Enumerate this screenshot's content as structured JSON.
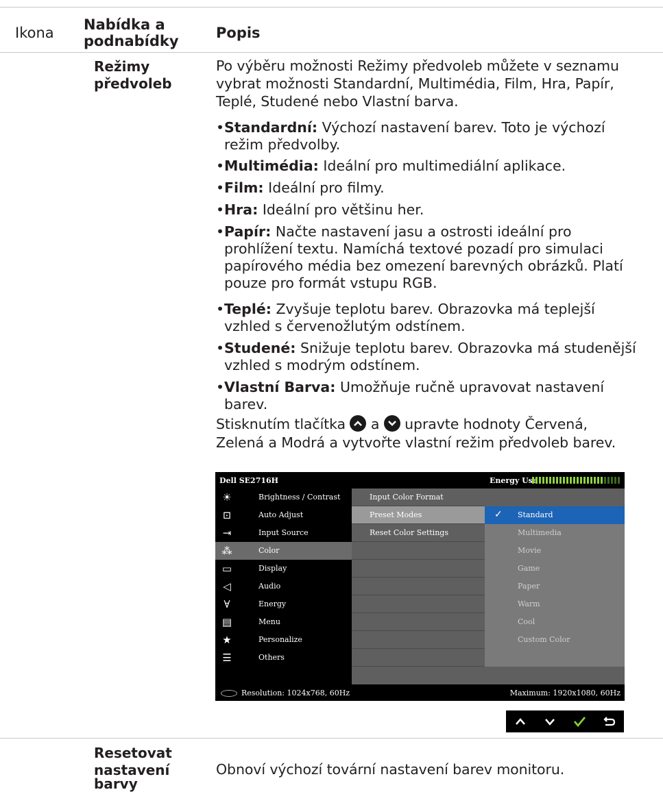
{
  "header": {
    "col1": "Ikona",
    "col2_line1": "Nabídka a",
    "col2_line2": "podnabídky",
    "col3": "Popis"
  },
  "section1": {
    "label_line1": "Režimy",
    "label_line2": "předvoleb",
    "intro": [
      "Po výběru možnosti Režimy předvoleb můžete v seznamu",
      "vybrat možnosti Standardní, Multimédia, Film, Hra, Papír,",
      "Teplé, Studené nebo Vlastní barva."
    ],
    "bullets": [
      {
        "term": "Standardní:",
        "lines": [
          "Výchozí nastavení barev. Toto je výchozí",
          "režim předvolby."
        ]
      },
      {
        "term": "Multimédia:",
        "lines": [
          "Ideální pro multimediální aplikace."
        ]
      },
      {
        "term": "Film:",
        "lines": [
          "Ideální pro filmy."
        ]
      },
      {
        "term": "Hra:",
        "lines": [
          "Ideální pro většinu her."
        ]
      },
      {
        "term": "Papír:",
        "lines": [
          "Načte nastavení jasu a ostrosti ideální pro",
          "prohlížení textu. Namíchá textové pozadí pro simulaci",
          "papírového média bez omezení barevných obrázků. Platí",
          "pouze pro formát vstupu RGB."
        ]
      },
      {
        "term": "Teplé:",
        "lines": [
          "Zvyšuje teplotu barev. Obrazovka má teplejší",
          "vzhled s červenožlutým odstínem."
        ]
      },
      {
        "term": "Studené:",
        "lines": [
          "Snižuje teplotu barev. Obrazovka má studenější",
          "vzhled s modrým odstínem."
        ]
      },
      {
        "term": "Vlastní Barva:",
        "lines": [
          "Umožňuje ručně upravovat nastavení",
          "barev."
        ]
      }
    ],
    "press_pre": "Stisknutím tlačítka",
    "press_mid": "a",
    "press_post": "upravte hodnoty Červená,",
    "press_line2": "Zelená a Modrá a vytvořte vlastní režim předvoleb barev."
  },
  "osd": {
    "title": "Dell SE2716H",
    "energy_label": "Energy Use",
    "energy_level": 0.8,
    "menu": [
      {
        "icon": "brightness-icon",
        "label": "Brightness / Contrast"
      },
      {
        "icon": "auto-adjust-icon",
        "label": "Auto Adjust"
      },
      {
        "icon": "input-source-icon",
        "label": "Input Source"
      },
      {
        "icon": "color-icon",
        "label": "Color"
      },
      {
        "icon": "display-icon",
        "label": "Display"
      },
      {
        "icon": "audio-icon",
        "label": "Audio"
      },
      {
        "icon": "energy-icon",
        "label": "Energy"
      },
      {
        "icon": "menu-icon",
        "label": "Menu"
      },
      {
        "icon": "star-icon",
        "label": "Personalize"
      },
      {
        "icon": "others-icon",
        "label": "Others"
      }
    ],
    "selected_menu": "Color",
    "submenu": [
      "Input Color Format",
      "Preset Modes",
      "Reset Color Settings"
    ],
    "selected_submenu": "Preset Modes",
    "options": [
      "Standard",
      "Multimedia",
      "Movie",
      "Game",
      "Paper",
      "Warm",
      "Cool",
      "Custom Color"
    ],
    "selected_option": "Standard",
    "resolution": "Resolution: 1024x768, 60Hz",
    "maximum": "Maximum: 1920x1080, 60Hz",
    "accent_color": "#1c64b6"
  },
  "section2": {
    "label_line1": "Resetovat",
    "label_line2": "nastavení",
    "label_line3": "barvy",
    "text": "Obnoví výchozí tovární nastavení barev monitoru."
  }
}
